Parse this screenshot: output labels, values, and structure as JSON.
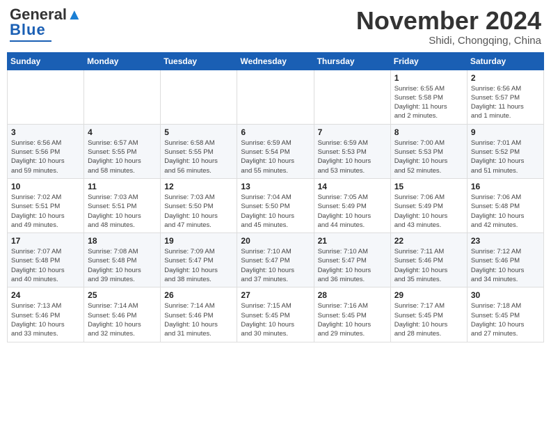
{
  "header": {
    "logo_general": "General",
    "logo_blue": "Blue",
    "month": "November 2024",
    "location": "Shidi, Chongqing, China"
  },
  "weekdays": [
    "Sunday",
    "Monday",
    "Tuesday",
    "Wednesday",
    "Thursday",
    "Friday",
    "Saturday"
  ],
  "weeks": [
    [
      {
        "day": "",
        "info": ""
      },
      {
        "day": "",
        "info": ""
      },
      {
        "day": "",
        "info": ""
      },
      {
        "day": "",
        "info": ""
      },
      {
        "day": "",
        "info": ""
      },
      {
        "day": "1",
        "info": "Sunrise: 6:55 AM\nSunset: 5:58 PM\nDaylight: 11 hours\nand 2 minutes."
      },
      {
        "day": "2",
        "info": "Sunrise: 6:56 AM\nSunset: 5:57 PM\nDaylight: 11 hours\nand 1 minute."
      }
    ],
    [
      {
        "day": "3",
        "info": "Sunrise: 6:56 AM\nSunset: 5:56 PM\nDaylight: 10 hours\nand 59 minutes."
      },
      {
        "day": "4",
        "info": "Sunrise: 6:57 AM\nSunset: 5:55 PM\nDaylight: 10 hours\nand 58 minutes."
      },
      {
        "day": "5",
        "info": "Sunrise: 6:58 AM\nSunset: 5:55 PM\nDaylight: 10 hours\nand 56 minutes."
      },
      {
        "day": "6",
        "info": "Sunrise: 6:59 AM\nSunset: 5:54 PM\nDaylight: 10 hours\nand 55 minutes."
      },
      {
        "day": "7",
        "info": "Sunrise: 6:59 AM\nSunset: 5:53 PM\nDaylight: 10 hours\nand 53 minutes."
      },
      {
        "day": "8",
        "info": "Sunrise: 7:00 AM\nSunset: 5:53 PM\nDaylight: 10 hours\nand 52 minutes."
      },
      {
        "day": "9",
        "info": "Sunrise: 7:01 AM\nSunset: 5:52 PM\nDaylight: 10 hours\nand 51 minutes."
      }
    ],
    [
      {
        "day": "10",
        "info": "Sunrise: 7:02 AM\nSunset: 5:51 PM\nDaylight: 10 hours\nand 49 minutes."
      },
      {
        "day": "11",
        "info": "Sunrise: 7:03 AM\nSunset: 5:51 PM\nDaylight: 10 hours\nand 48 minutes."
      },
      {
        "day": "12",
        "info": "Sunrise: 7:03 AM\nSunset: 5:50 PM\nDaylight: 10 hours\nand 47 minutes."
      },
      {
        "day": "13",
        "info": "Sunrise: 7:04 AM\nSunset: 5:50 PM\nDaylight: 10 hours\nand 45 minutes."
      },
      {
        "day": "14",
        "info": "Sunrise: 7:05 AM\nSunset: 5:49 PM\nDaylight: 10 hours\nand 44 minutes."
      },
      {
        "day": "15",
        "info": "Sunrise: 7:06 AM\nSunset: 5:49 PM\nDaylight: 10 hours\nand 43 minutes."
      },
      {
        "day": "16",
        "info": "Sunrise: 7:06 AM\nSunset: 5:48 PM\nDaylight: 10 hours\nand 42 minutes."
      }
    ],
    [
      {
        "day": "17",
        "info": "Sunrise: 7:07 AM\nSunset: 5:48 PM\nDaylight: 10 hours\nand 40 minutes."
      },
      {
        "day": "18",
        "info": "Sunrise: 7:08 AM\nSunset: 5:48 PM\nDaylight: 10 hours\nand 39 minutes."
      },
      {
        "day": "19",
        "info": "Sunrise: 7:09 AM\nSunset: 5:47 PM\nDaylight: 10 hours\nand 38 minutes."
      },
      {
        "day": "20",
        "info": "Sunrise: 7:10 AM\nSunset: 5:47 PM\nDaylight: 10 hours\nand 37 minutes."
      },
      {
        "day": "21",
        "info": "Sunrise: 7:10 AM\nSunset: 5:47 PM\nDaylight: 10 hours\nand 36 minutes."
      },
      {
        "day": "22",
        "info": "Sunrise: 7:11 AM\nSunset: 5:46 PM\nDaylight: 10 hours\nand 35 minutes."
      },
      {
        "day": "23",
        "info": "Sunrise: 7:12 AM\nSunset: 5:46 PM\nDaylight: 10 hours\nand 34 minutes."
      }
    ],
    [
      {
        "day": "24",
        "info": "Sunrise: 7:13 AM\nSunset: 5:46 PM\nDaylight: 10 hours\nand 33 minutes."
      },
      {
        "day": "25",
        "info": "Sunrise: 7:14 AM\nSunset: 5:46 PM\nDaylight: 10 hours\nand 32 minutes."
      },
      {
        "day": "26",
        "info": "Sunrise: 7:14 AM\nSunset: 5:46 PM\nDaylight: 10 hours\nand 31 minutes."
      },
      {
        "day": "27",
        "info": "Sunrise: 7:15 AM\nSunset: 5:45 PM\nDaylight: 10 hours\nand 30 minutes."
      },
      {
        "day": "28",
        "info": "Sunrise: 7:16 AM\nSunset: 5:45 PM\nDaylight: 10 hours\nand 29 minutes."
      },
      {
        "day": "29",
        "info": "Sunrise: 7:17 AM\nSunset: 5:45 PM\nDaylight: 10 hours\nand 28 minutes."
      },
      {
        "day": "30",
        "info": "Sunrise: 7:18 AM\nSunset: 5:45 PM\nDaylight: 10 hours\nand 27 minutes."
      }
    ]
  ]
}
